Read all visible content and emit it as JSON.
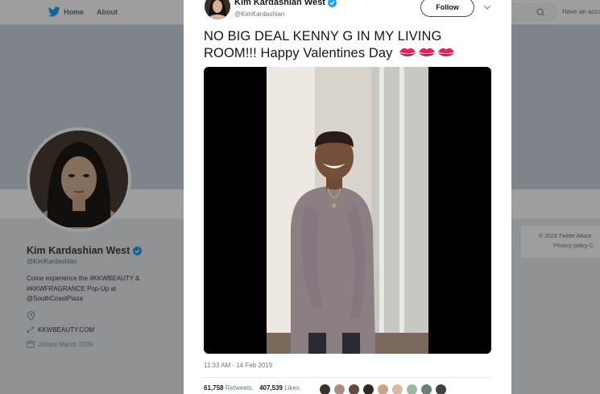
{
  "nav": {
    "home_label": "Home",
    "about_label": "About",
    "account_label": "Have an acco"
  },
  "profile": {
    "name": "Kim Kardashian West",
    "handle": "@KimKardashian",
    "bio": "Come experience the #KKWBEAUTY & #KKWFRAGRANCE Pop-Up at @SouthCoastPlaza",
    "website": "KKWBEAUTY.COM",
    "joined": "Joined March 2009"
  },
  "footer": {
    "line1": "© 2019 Twitter   About",
    "line2": "Privacy policy   C"
  },
  "tweet": {
    "author_name": "Kim Kardashian West",
    "author_handle": "@KimKardashian",
    "follow_label": "Follow",
    "text": "NO BIG DEAL KENNY G IN MY LIVING ROOM!!! Happy Valentines Day",
    "emoji": [
      "kiss-mark",
      "kiss-mark",
      "kiss-mark"
    ],
    "timestamp": "11:33 AM - 14 Feb 2019",
    "retweets_count": "61,758",
    "retweets_label": "Retweets",
    "likes_count": "407,539",
    "likes_label": "Likes"
  },
  "colors": {
    "accent": "#1da1f2",
    "verified": "#1da1f2",
    "kiss": "#e0245e"
  },
  "icons": {
    "logo": "twitter-bird-icon",
    "search": "search-icon",
    "verified": "verified-badge-icon",
    "location": "location-pin-icon",
    "link": "link-icon",
    "calendar": "calendar-icon",
    "more": "chevron-down-icon"
  }
}
